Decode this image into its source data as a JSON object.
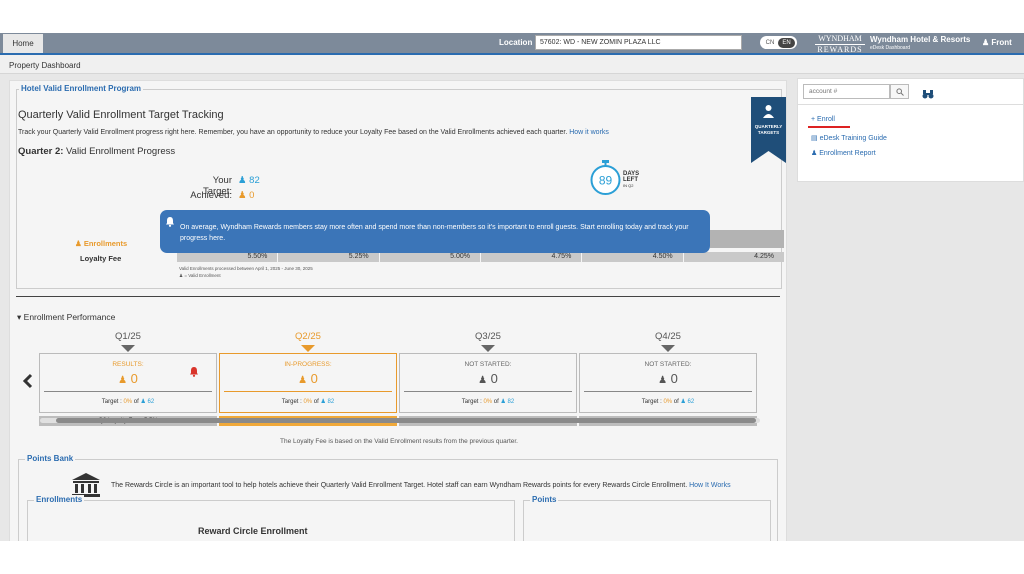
{
  "topbar": {
    "home": "Home",
    "location_label": "Location",
    "location_value": "57602: WD - NEW ZOMIN PLAZA LLC",
    "lang_cn": "CN",
    "lang_en": "EN",
    "logo_line1": "WYNDHAM",
    "logo_line2": "REWARDS",
    "hotel_name": "Wyndham Hotel & Resorts",
    "hotel_sub": "eDesk Dashboard",
    "user": "Front"
  },
  "breadcrumb": "Property Dashboard",
  "program": {
    "legend": "Hotel Valid Enrollment Program",
    "title": "Quarterly Valid Enrollment Target Tracking",
    "description": "Track your Quarterly Valid Enrollment progress right here. Remember, you have an opportunity to reduce your Loyalty Fee based on the Valid Enrollments achieved each quarter.",
    "how_link": "How it works",
    "quarter_bold": "Quarter 2:",
    "quarter_rest": "Valid Enrollment Progress",
    "badge_line1": "QUARTERLY",
    "badge_line2": "TARGETS",
    "target_label": "Your Target:",
    "target_value": "82",
    "achieved_label": "Achieved:",
    "achieved_value": "0",
    "days_number": "89",
    "days_l1": "DAYS",
    "days_l2": "LEFT",
    "days_l3": "IN Q2",
    "tooltip": "On average, Wyndham Rewards members stay more often and spend more than non-members so it's important to enroll guests. Start enrolling today and track your progress here.",
    "enrollments_label": "Enrollments",
    "loyalty_fee_label": "Loyalty Fee",
    "fees": [
      "5.50%",
      "5.25%",
      "5.00%",
      "4.75%",
      "4.50%",
      "4.25%"
    ],
    "note1": "Valid Enrollments processed between April 1, 2025 - June 30, 2025",
    "note2": "= Valid Enrollment"
  },
  "performance": {
    "title": "Enrollment Performance",
    "quarters": [
      {
        "name": "Q1/25",
        "status": "RESULTS:",
        "value": "0",
        "target_prefix": "Target :",
        "pct": "0%",
        "of": "of",
        "target": "62",
        "bar": "Q2 Loyalty Fee : 5.5%"
      },
      {
        "name": "Q2/25",
        "status": "IN-PROGRESS:",
        "value": "0",
        "target_prefix": "Target :",
        "pct": "0%",
        "of": "of",
        "target": "82",
        "bar": "-"
      },
      {
        "name": "Q3/25",
        "status": "NOT STARTED:",
        "value": "0",
        "target_prefix": "Target :",
        "pct": "0%",
        "of": "of",
        "target": "82",
        "bar": "-"
      },
      {
        "name": "Q4/25",
        "status": "NOT STARTED:",
        "value": "0",
        "target_prefix": "Target :",
        "pct": "0%",
        "of": "of",
        "target": "62",
        "bar": "-"
      }
    ],
    "fee_note": "The Loyalty Fee is based on the Valid Enrollment results from the previous quarter."
  },
  "points_bank": {
    "legend": "Points Bank",
    "description": "The Rewards Circle is an important tool to help hotels achieve their Quarterly Valid Enrollment Target. Hotel staff can earn Wyndham Rewards points for every Rewards Circle Enrollment.",
    "how_link": "How It Works",
    "enrollments_legend": "Enrollments",
    "points_legend": "Points",
    "rc_title": "Reward Circle Enrollment"
  },
  "sidebar": {
    "account_placeholder": "account #",
    "enroll": "Enroll",
    "training": "eDesk Training Guide",
    "report": "Enrollment Report"
  },
  "colors": {
    "accent": "#2b6cb0",
    "orange": "#e89a2c",
    "navy": "#1f4e79"
  }
}
